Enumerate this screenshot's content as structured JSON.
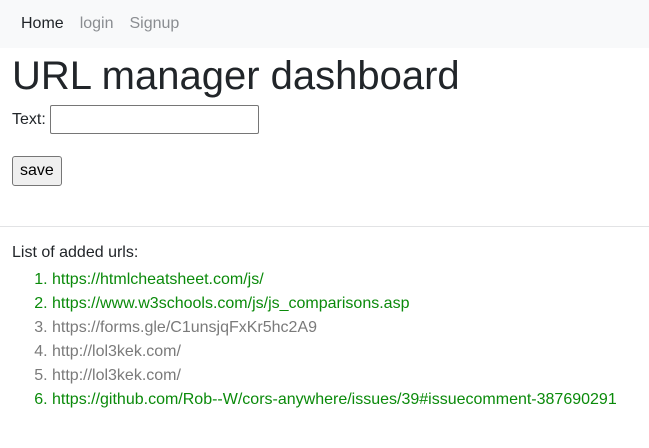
{
  "nav": {
    "items": [
      {
        "label": "Home",
        "active": true
      },
      {
        "label": "login",
        "active": false
      },
      {
        "label": "Signup",
        "active": false
      }
    ]
  },
  "main": {
    "title": "URL manager dashboard",
    "form": {
      "text_label": "Text:",
      "text_value": "",
      "save_label": "save"
    },
    "list_heading": "List of added urls:",
    "urls": [
      {
        "url": "https://htmlcheatsheet.com/js/",
        "status_color": "#0a8a0a"
      },
      {
        "url": "https://www.w3schools.com/js/js_comparisons.asp",
        "status_color": "#0a8a0a"
      },
      {
        "url": "https://forms.gle/C1unsjqFxKr5hc2A9",
        "status_color": "#7a7a7a"
      },
      {
        "url": "http://lol3kek.com/",
        "status_color": "#7a7a7a"
      },
      {
        "url": "http://lol3kek.com/",
        "status_color": "#7a7a7a"
      },
      {
        "url": "https://github.com/Rob--W/cors-anywhere/issues/39#issuecomment-387690291",
        "status_color": "#0a8a0a"
      }
    ]
  }
}
